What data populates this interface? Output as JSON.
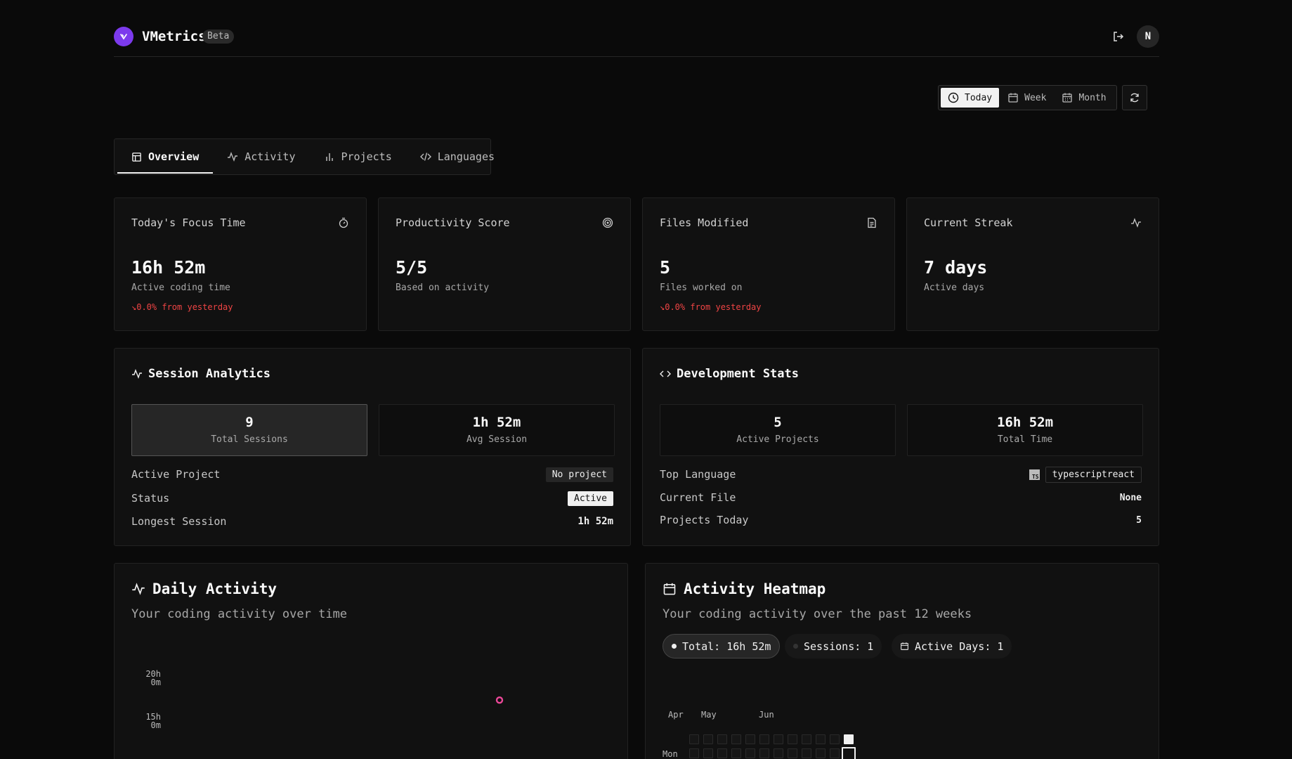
{
  "header": {
    "brand": "VMetrics",
    "badge": "Beta",
    "avatar_initial": "N",
    "logo_color": "#7c3aed"
  },
  "range": {
    "options": [
      "Today",
      "Week",
      "Month"
    ],
    "selected": "Today"
  },
  "tabs": [
    {
      "label": "Overview",
      "icon": "layout-icon",
      "active": true
    },
    {
      "label": "Activity",
      "icon": "activity-icon",
      "active": false
    },
    {
      "label": "Projects",
      "icon": "bar-chart-icon",
      "active": false
    },
    {
      "label": "Languages",
      "icon": "code-icon",
      "active": false
    }
  ],
  "stats": [
    {
      "title": "Today's Focus Time",
      "icon": "timer-icon",
      "value": "16h 52m",
      "sub": "Active coding time",
      "change": "0.0% from yesterday"
    },
    {
      "title": "Productivity Score",
      "icon": "target-icon",
      "value": "5/5",
      "sub": "Based on activity",
      "change": ""
    },
    {
      "title": "Files Modified",
      "icon": "file-icon",
      "value": "5",
      "sub": "Files worked on",
      "change": "0.0% from yesterday"
    },
    {
      "title": "Current Streak",
      "icon": "activity-icon",
      "value": "7 days",
      "sub": "Active days",
      "change": ""
    }
  ],
  "session": {
    "title": "Session Analytics",
    "total_sessions_value": "9",
    "total_sessions_label": "Total Sessions",
    "avg_session_value": "1h 52m",
    "avg_session_label": "Avg Session",
    "rows": {
      "active_project_label": "Active Project",
      "active_project_value": "No project",
      "status_label": "Status",
      "status_value": "Active",
      "longest_label": "Longest Session",
      "longest_value": "1h 52m"
    }
  },
  "dev": {
    "title": "Development Stats",
    "active_projects_value": "5",
    "active_projects_label": "Active Projects",
    "total_time_value": "16h 52m",
    "total_time_label": "Total Time",
    "rows": {
      "top_language_label": "Top Language",
      "top_language_badge": "TS",
      "top_language_value": "typescriptreact",
      "current_file_label": "Current File",
      "current_file_value": "None",
      "projects_today_label": "Projects Today",
      "projects_today_value": "5"
    }
  },
  "daily": {
    "title": "Daily Activity",
    "subtitle": "Your coding activity over time",
    "y_ticks": [
      {
        "line1": "20h",
        "line2": "0m"
      },
      {
        "line1": "15h",
        "line2": "0m"
      }
    ],
    "point_color": "#ec4899"
  },
  "chart_data": {
    "type": "line",
    "title": "Daily Activity",
    "subtitle": "Your coding activity over time",
    "y_tick_labels": [
      "20h 0m",
      "15h 0m"
    ],
    "series": [
      {
        "values": [
          16.87
        ]
      }
    ],
    "grid": false
  },
  "heatmap": {
    "title": "Activity Heatmap",
    "subtitle": "Your coding activity over the past 12 weeks",
    "chips": {
      "total": "Total: 16h 52m",
      "sessions": "Sessions: 1",
      "active_days": "Active Days: 1"
    },
    "months": [
      "Apr",
      "May",
      "Jun"
    ],
    "day_label": "Mon"
  }
}
